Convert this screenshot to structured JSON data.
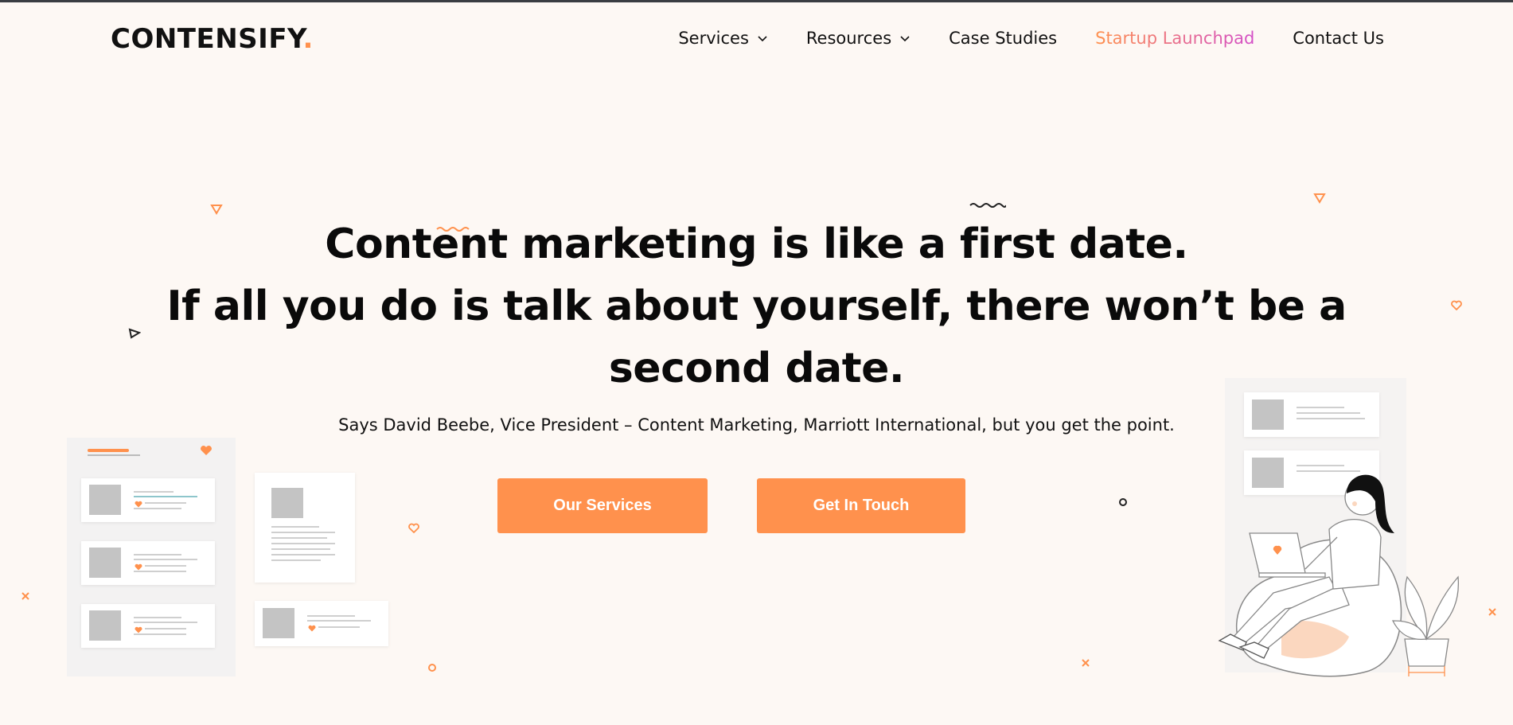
{
  "brand": {
    "name": "CONTENSIFY",
    "dot": ".",
    "accent": "#ff914d",
    "gradient_end": "#d34ec8"
  },
  "nav": {
    "services": "Services",
    "resources": "Resources",
    "case_studies": "Case Studies",
    "startup": "Startup Launchpad",
    "contact": "Contact Us"
  },
  "hero": {
    "line1": "Content marketing is like a first date.",
    "line2": "If all you do is talk about yourself, there won’t be a",
    "line3": "second date.",
    "subtitle": "Says David Beebe, Vice President – Content Marketing, Marriott International, but you get the point."
  },
  "buttons": {
    "services": "Our Services",
    "touch": "Get In Touch"
  },
  "icons": [
    "chevron-down-icon",
    "heart-icon",
    "triangle-icon",
    "circle-icon",
    "cross-icon",
    "squiggle-icon"
  ]
}
